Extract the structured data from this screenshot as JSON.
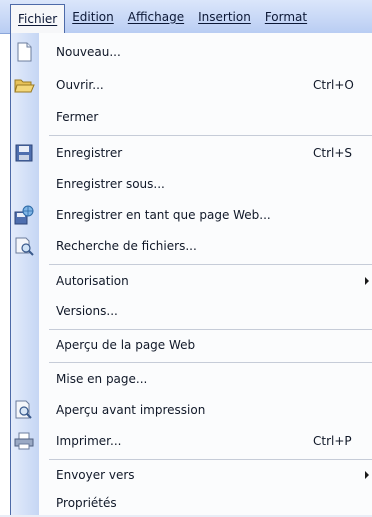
{
  "menubar": {
    "items": [
      {
        "label": "Fichier",
        "active": true
      },
      {
        "label": "Edition"
      },
      {
        "label": "Affichage"
      },
      {
        "label": "Insertion"
      },
      {
        "label": "Format"
      }
    ]
  },
  "menu": {
    "items": [
      {
        "label": "Nouveau...",
        "icon": "new-document-icon"
      },
      {
        "label": "Ouvrir...",
        "shortcut": "Ctrl+O",
        "icon": "open-folder-icon"
      },
      {
        "label": "Fermer"
      },
      {
        "label": "Enregistrer",
        "shortcut": "Ctrl+S",
        "icon": "save-disk-icon"
      },
      {
        "label": "Enregistrer sous..."
      },
      {
        "label": "Enregistrer en tant que page Web...",
        "icon": "save-web-page-icon"
      },
      {
        "label": "Recherche de fichiers...",
        "icon": "file-search-icon"
      },
      {
        "label": "Autorisation",
        "submenu": true
      },
      {
        "label": "Versions..."
      },
      {
        "label": "Aperçu de la page Web"
      },
      {
        "label": "Mise en page..."
      },
      {
        "label": "Aperçu avant impression",
        "icon": "print-preview-icon"
      },
      {
        "label": "Imprimer...",
        "shortcut": "Ctrl+P",
        "icon": "printer-icon"
      },
      {
        "label": "Envoyer vers",
        "submenu": true
      },
      {
        "label": "Propriétés"
      }
    ]
  },
  "colors": {
    "menubar_top": "#dbe6fb",
    "menubar_bottom": "#b9cdf3",
    "icon_strip": "#c5d6f4",
    "border": "#4d6aa8"
  }
}
